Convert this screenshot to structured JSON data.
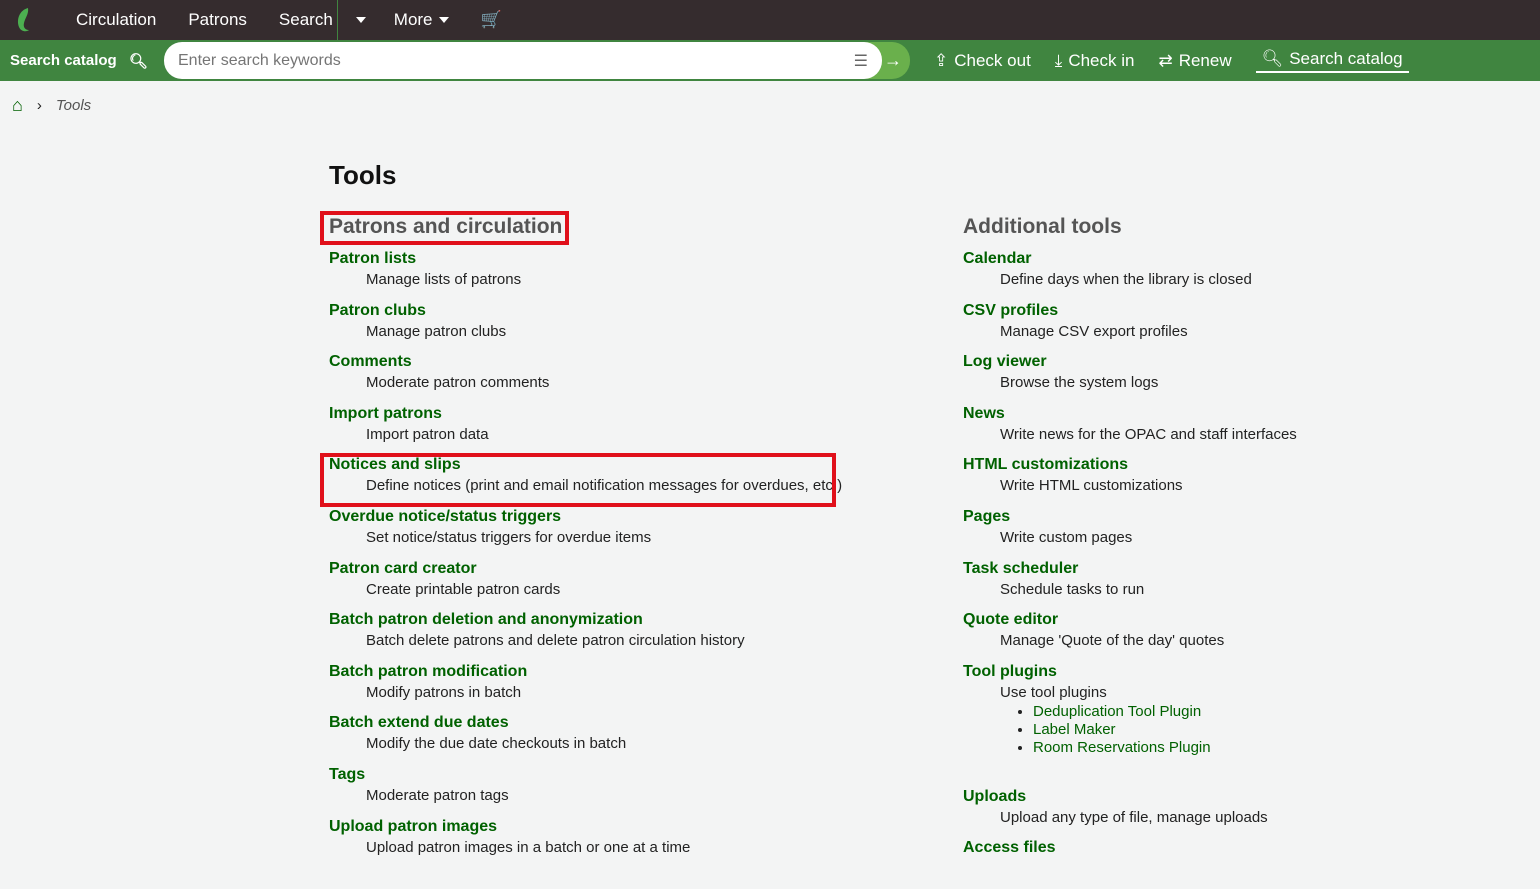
{
  "nav": {
    "items": [
      "Circulation",
      "Patrons",
      "Search",
      "More"
    ]
  },
  "bar": {
    "search_label": "Search catalog",
    "placeholder": "Enter search keywords",
    "actions": [
      "Check out",
      "Check in",
      "Renew",
      "Search catalog"
    ]
  },
  "breadcrumb": {
    "current": "Tools"
  },
  "title": "Tools",
  "left": {
    "heading": "Patrons and circulation",
    "items": [
      {
        "t": "Patron lists",
        "d": "Manage lists of patrons"
      },
      {
        "t": "Patron clubs",
        "d": "Manage patron clubs"
      },
      {
        "t": "Comments",
        "d": "Moderate patron comments"
      },
      {
        "t": "Import patrons",
        "d": "Import patron data"
      },
      {
        "t": "Notices and slips",
        "d": "Define notices (print and email notification messages for overdues, etc.)"
      },
      {
        "t": "Overdue notice/status triggers",
        "d": "Set notice/status triggers for overdue items"
      },
      {
        "t": "Patron card creator",
        "d": "Create printable patron cards"
      },
      {
        "t": "Batch patron deletion and anonymization",
        "d": "Batch delete patrons and delete patron circulation history"
      },
      {
        "t": "Batch patron modification",
        "d": "Modify patrons in batch"
      },
      {
        "t": "Batch extend due dates",
        "d": "Modify the due date checkouts in batch"
      },
      {
        "t": "Tags",
        "d": "Moderate patron tags"
      },
      {
        "t": "Upload patron images",
        "d": "Upload patron images in a batch or one at a time"
      }
    ]
  },
  "right": {
    "heading": "Additional tools",
    "items": [
      {
        "t": "Calendar",
        "d": "Define days when the library is closed"
      },
      {
        "t": "CSV profiles",
        "d": "Manage CSV export profiles"
      },
      {
        "t": "Log viewer",
        "d": "Browse the system logs"
      },
      {
        "t": "News",
        "d": "Write news for the OPAC and staff interfaces"
      },
      {
        "t": "HTML customizations",
        "d": "Write HTML customizations"
      },
      {
        "t": "Pages",
        "d": "Write custom pages"
      },
      {
        "t": "Task scheduler",
        "d": "Schedule tasks to run"
      },
      {
        "t": "Quote editor",
        "d": "Manage 'Quote of the day' quotes"
      },
      {
        "t": "Tool plugins",
        "d": "Use tool plugins"
      }
    ],
    "plugins": [
      "Deduplication Tool Plugin",
      "Label Maker",
      "Room Reservations Plugin"
    ],
    "after": [
      {
        "t": "Uploads",
        "d": "Upload any type of file, manage uploads"
      },
      {
        "t": "Access files",
        "d": ""
      }
    ]
  }
}
